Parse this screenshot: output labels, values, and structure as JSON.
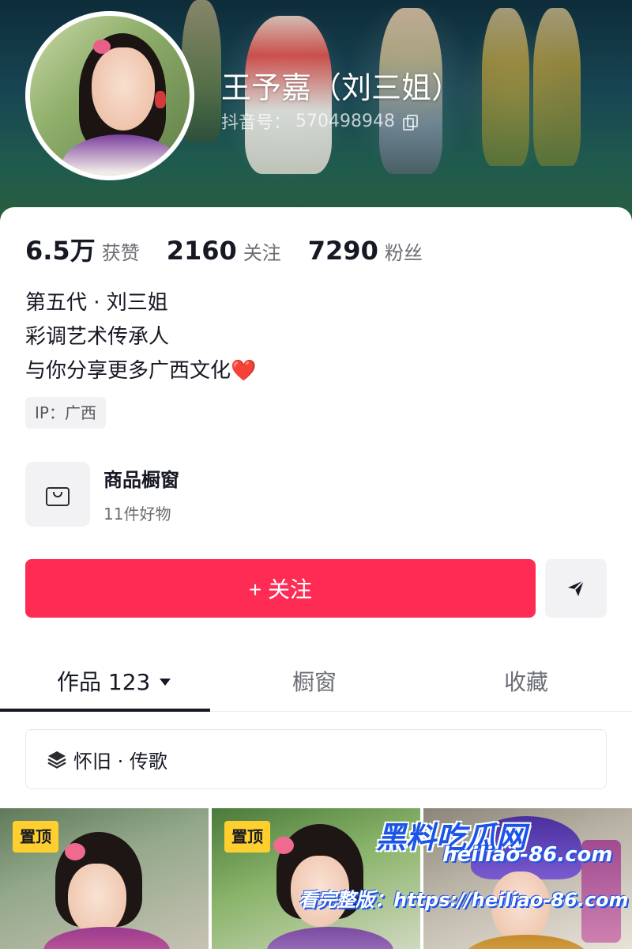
{
  "profile": {
    "name": "王予嘉（刘三姐）",
    "douyin_id_label": "抖音号：",
    "douyin_id": "570498948"
  },
  "stats": {
    "likes": {
      "value": "6.5万",
      "label": "获赞"
    },
    "following": {
      "value": "2160",
      "label": "关注"
    },
    "followers": {
      "value": "7290",
      "label": "粉丝"
    }
  },
  "bio": {
    "line1": "第五代 · 刘三姐",
    "line2": "彩调艺术传承人",
    "line3": "与你分享更多广西文化",
    "emoji": "❤️"
  },
  "ip_tag": "IP：广西",
  "shop": {
    "title": "商品橱窗",
    "subtitle": "11件好物",
    "icon": "shopping-bag-icon"
  },
  "actions": {
    "follow_label": "+ 关注",
    "send_icon": "send-icon"
  },
  "tabs": {
    "works": "作品 123",
    "window": "橱窗",
    "favorites": "收藏"
  },
  "collection": {
    "label": "怀旧 · 传歌",
    "icon": "layers-icon"
  },
  "thumbnails": {
    "pin_label": "置顶"
  },
  "watermark": {
    "logo": "黑料吃瓜网",
    "domain": "heiliao-86.com",
    "line": "看完整版：https://heiliao-86.com"
  },
  "colors": {
    "accent": "#fe2c55",
    "pin_badge": "#fecf2e",
    "watermark_blue": "#1a55e8"
  }
}
